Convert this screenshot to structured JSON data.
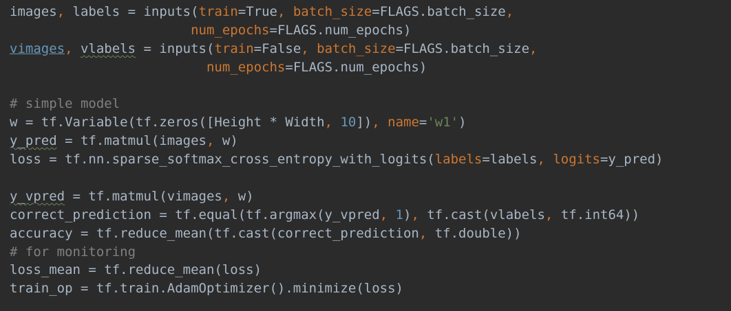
{
  "editor": {
    "colors": {
      "background": "#2b2b2b",
      "default_text": "#a9b7c6",
      "keyword_arg": "#cc7832",
      "number": "#6897bb",
      "string": "#6a8759",
      "comment": "#808080"
    },
    "lines": [
      [
        {
          "t": "images"
        },
        {
          "t": ", ",
          "c": "kw"
        },
        {
          "t": "labels = inputs("
        },
        {
          "t": "train",
          "c": "kw"
        },
        {
          "t": "=True"
        },
        {
          "t": ", ",
          "c": "kw"
        },
        {
          "t": "batch_size",
          "c": "kw"
        },
        {
          "t": "=FLAGS.batch_size"
        },
        {
          "t": ",",
          "c": "kw"
        }
      ],
      [
        {
          "t": "                       "
        },
        {
          "t": "num_epochs",
          "c": "kw"
        },
        {
          "t": "=FLAGS.num_epochs)"
        }
      ],
      [
        {
          "t": "vimages",
          "c": "link"
        },
        {
          "t": ", ",
          "c": "kw"
        },
        {
          "t": "vlabels",
          "c": "warn"
        },
        {
          "t": " = inputs("
        },
        {
          "t": "train",
          "c": "kw"
        },
        {
          "t": "=False"
        },
        {
          "t": ", ",
          "c": "kw"
        },
        {
          "t": "batch_size",
          "c": "kw"
        },
        {
          "t": "=FLAGS.batch_size"
        },
        {
          "t": ",",
          "c": "kw"
        }
      ],
      [
        {
          "t": "                         "
        },
        {
          "t": "num_epochs",
          "c": "kw"
        },
        {
          "t": "=FLAGS.num_epochs)"
        }
      ],
      [],
      [
        {
          "t": "# simple model",
          "c": "cmt"
        }
      ],
      [
        {
          "t": "w = tf.Variable(tf.zeros([Height * Width"
        },
        {
          "t": ", ",
          "c": "kw"
        },
        {
          "t": "10",
          "c": "num"
        },
        {
          "t": "])"
        },
        {
          "t": ", ",
          "c": "kw"
        },
        {
          "t": "name",
          "c": "kw"
        },
        {
          "t": "="
        },
        {
          "t": "'w1'",
          "c": "str"
        },
        {
          "t": ")"
        }
      ],
      [
        {
          "t": "y_pred",
          "c": "warn"
        },
        {
          "t": " = tf.matmul(images"
        },
        {
          "t": ", ",
          "c": "kw"
        },
        {
          "t": "w)"
        }
      ],
      [
        {
          "t": "loss = tf.nn.sparse_softmax_cross_entropy_with_logits("
        },
        {
          "t": "labels",
          "c": "kw"
        },
        {
          "t": "=labels"
        },
        {
          "t": ", ",
          "c": "kw"
        },
        {
          "t": "logits",
          "c": "kw"
        },
        {
          "t": "=y_pred)"
        }
      ],
      [],
      [
        {
          "t": "y_vpred",
          "c": "warn"
        },
        {
          "t": " = tf.matmul(vimages"
        },
        {
          "t": ", ",
          "c": "kw"
        },
        {
          "t": "w)"
        }
      ],
      [
        {
          "t": "correct_prediction = tf.equal(tf.argmax(y_vpred"
        },
        {
          "t": ", ",
          "c": "kw"
        },
        {
          "t": "1",
          "c": "num"
        },
        {
          "t": ")"
        },
        {
          "t": ", ",
          "c": "kw"
        },
        {
          "t": "tf.cast(vlabels"
        },
        {
          "t": ", ",
          "c": "kw"
        },
        {
          "t": "tf.int64))"
        }
      ],
      [
        {
          "t": "accuracy = tf.reduce_mean(tf.cast(correct_prediction"
        },
        {
          "t": ", ",
          "c": "kw"
        },
        {
          "t": "tf.double))"
        }
      ],
      [
        {
          "t": "# for monitoring",
          "c": "cmt"
        }
      ],
      [
        {
          "t": "loss_mean = tf.reduce_mean(loss)"
        }
      ],
      [
        {
          "t": "train_op = tf.train.AdamOptimizer().minimize(loss)"
        }
      ]
    ]
  }
}
